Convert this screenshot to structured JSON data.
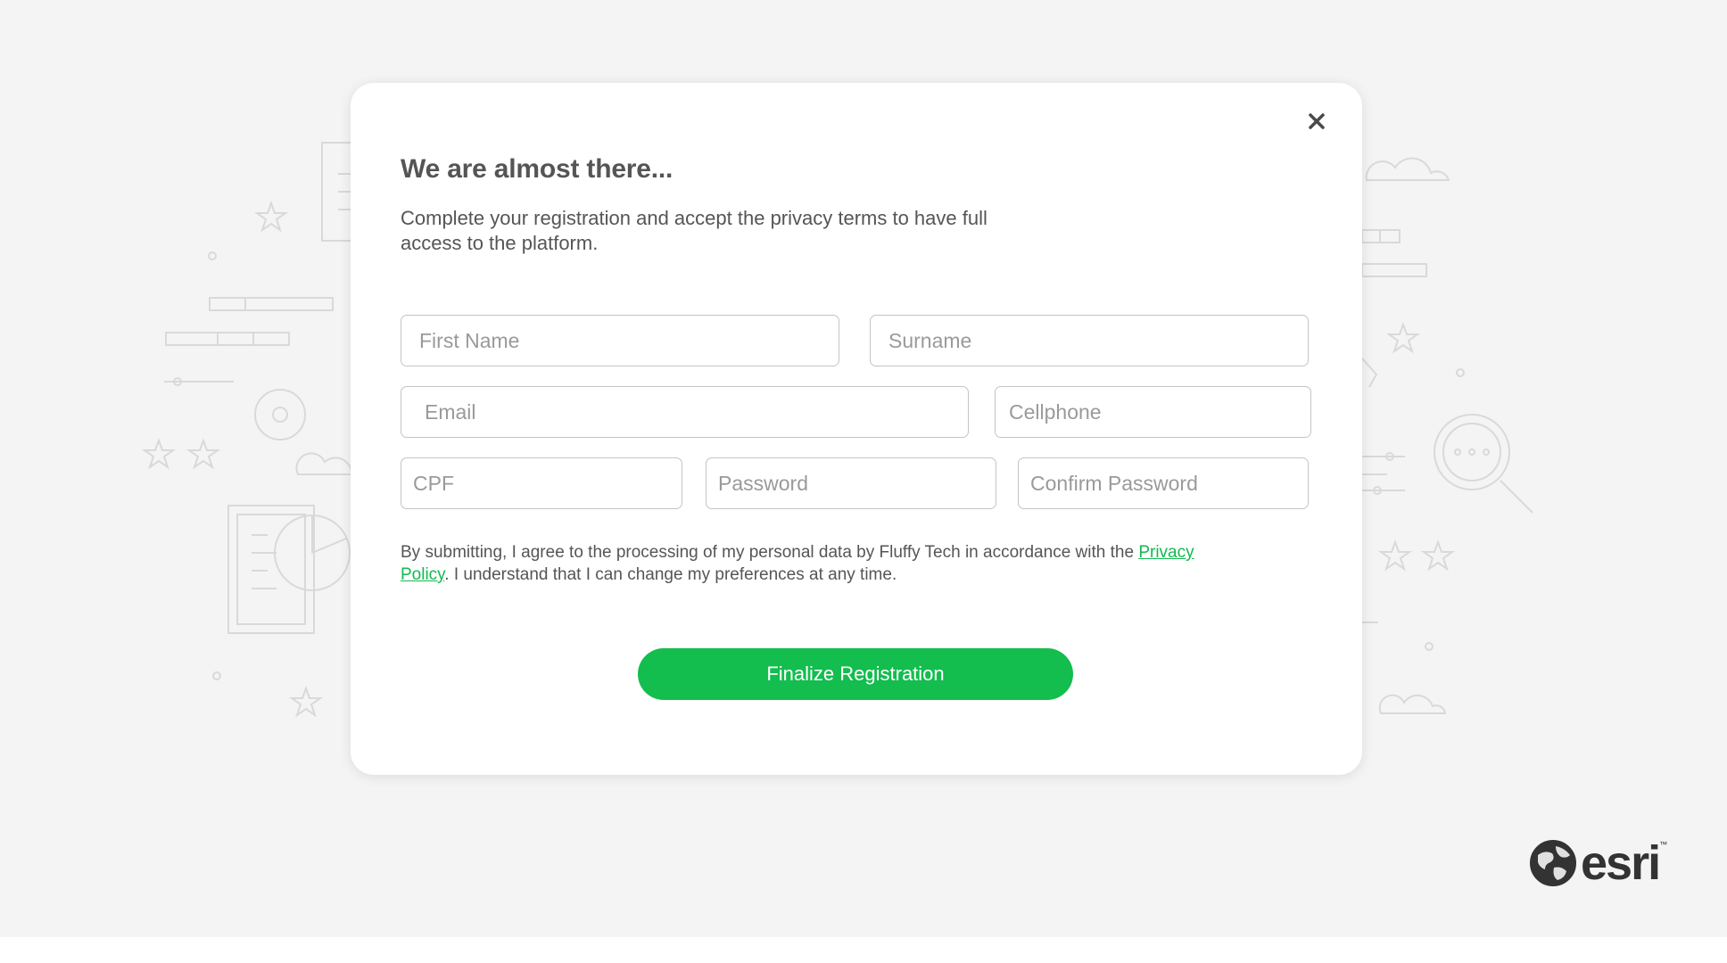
{
  "modal": {
    "title": "We are almost there...",
    "subtitle": "Complete your registration and accept the privacy terms to have full access to the platform.",
    "close_icon": "close-icon",
    "fields": {
      "first_name": {
        "placeholder": "First Name",
        "value": ""
      },
      "surname": {
        "placeholder": "Surname",
        "value": ""
      },
      "email": {
        "placeholder": "Email",
        "value": ""
      },
      "cellphone": {
        "placeholder": "Cellphone",
        "value": ""
      },
      "cpf": {
        "placeholder": "CPF",
        "value": ""
      },
      "password": {
        "placeholder": "Password",
        "value": ""
      },
      "confirm_password": {
        "placeholder": "Confirm Password",
        "value": ""
      }
    },
    "consent": {
      "before": "By submitting, I agree to the processing of my personal data by Fluffy Tech in accordance with the ",
      "link": "Privacy Policy",
      "after": ". I understand that I can change my preferences at any time."
    },
    "submit_label": "Finalize Registration"
  },
  "brand": {
    "logo_text": "esri",
    "logo_tm": "™",
    "logo_icon": "globe-icon"
  },
  "colors": {
    "accent": "#13bd4e",
    "link": "#13b94f",
    "backdrop": "#f4f4f4",
    "text": "#555555"
  }
}
